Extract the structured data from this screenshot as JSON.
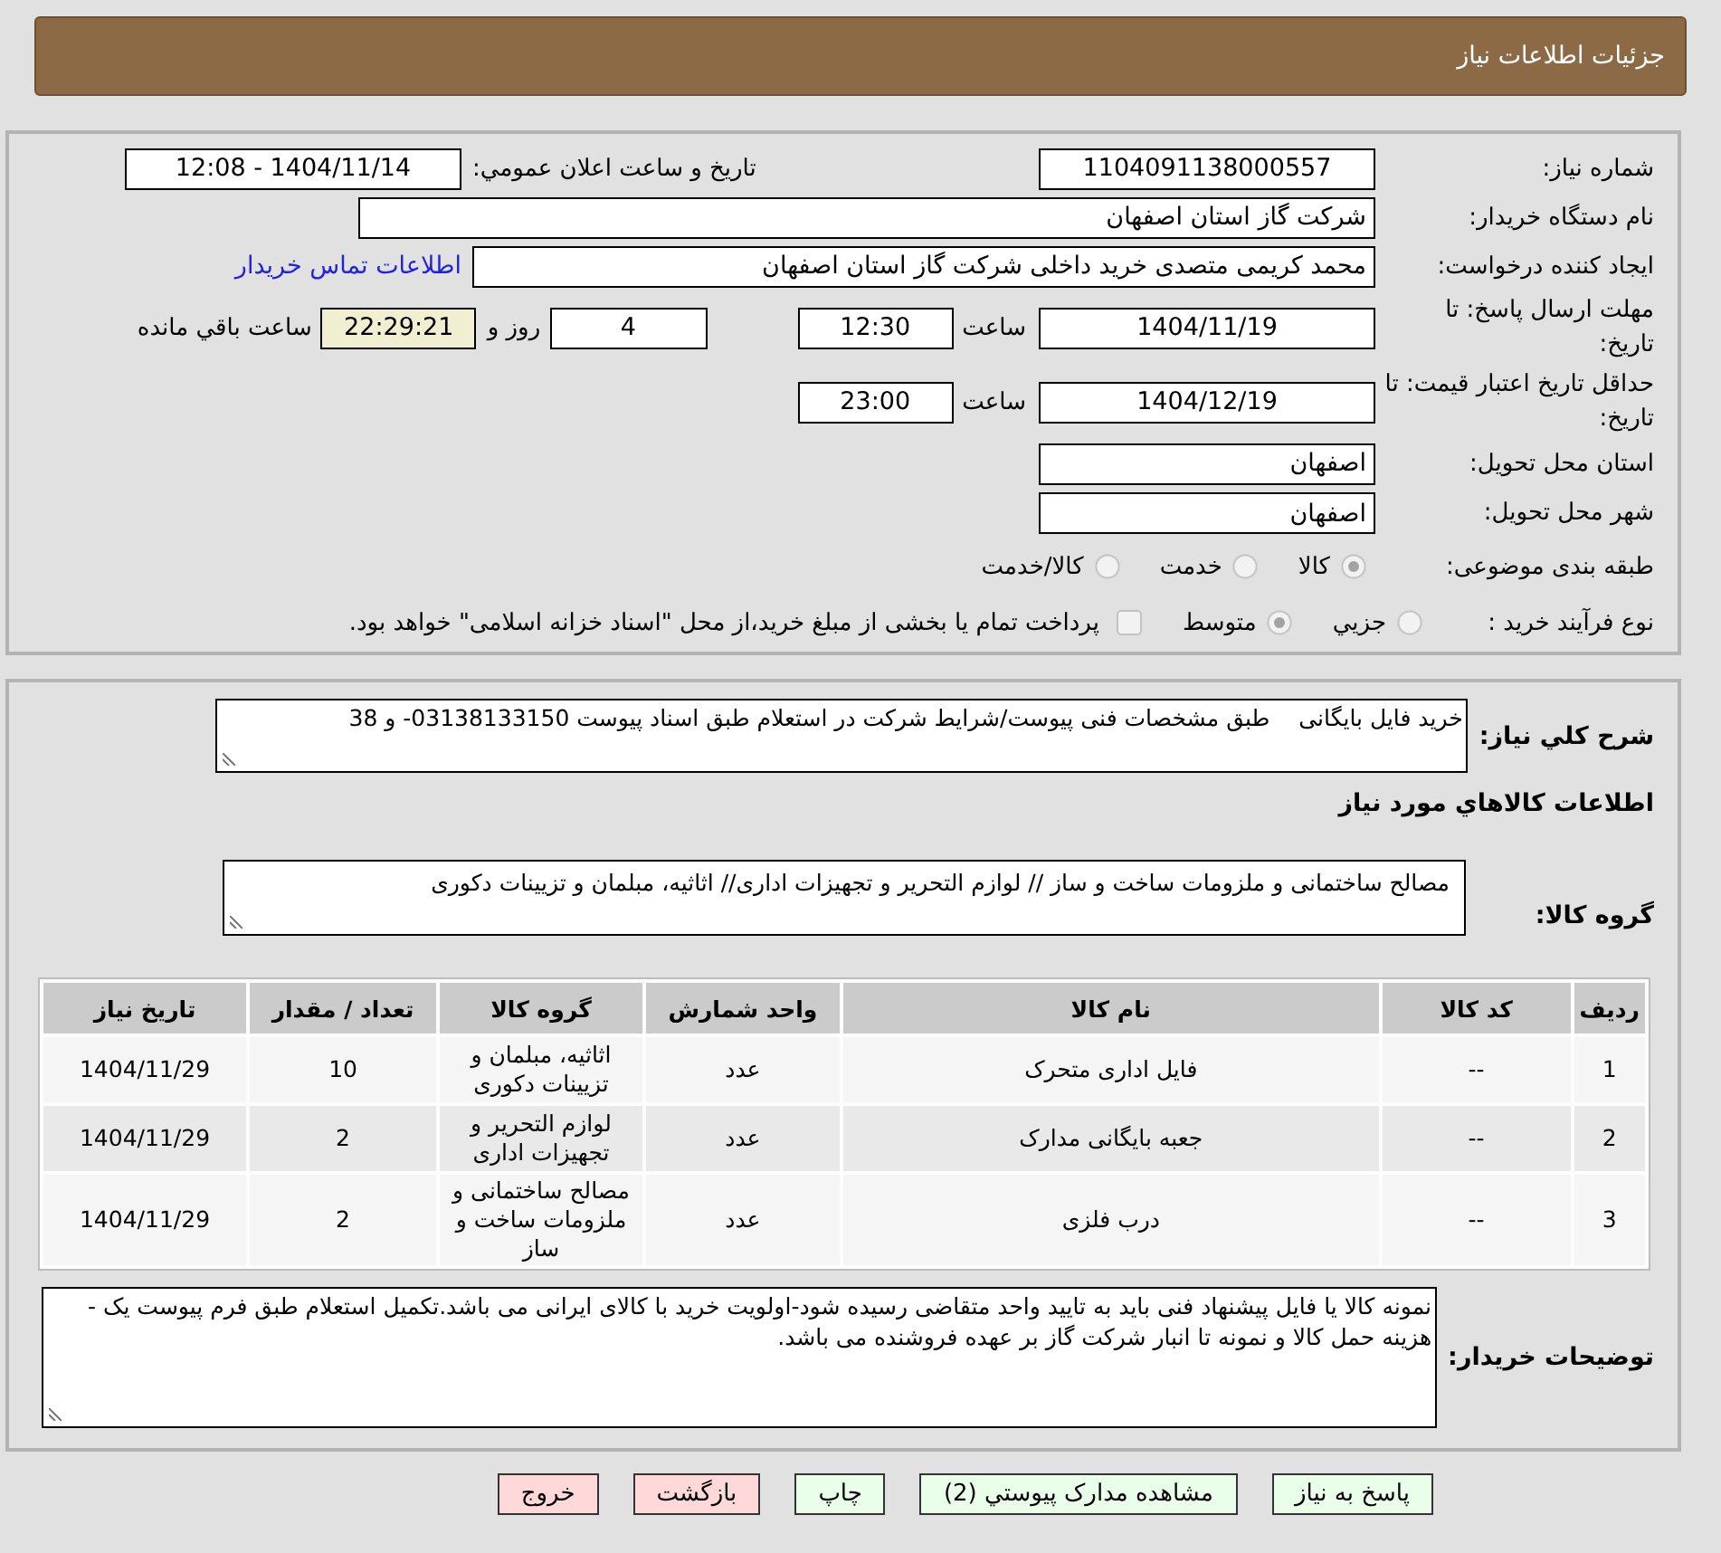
{
  "header": {
    "title": "جزئیات اطلاعات نیاز"
  },
  "need_info": {
    "need_number": {
      "label": "شماره نیاز:",
      "value": "1104091138000557"
    },
    "announcement": {
      "label": "تاریخ و ساعت اعلان عمومي:",
      "value": "1404/11/14 - 12:08"
    },
    "buyer_org": {
      "label": "نام دستگاه خریدار:",
      "value": "شرکت گاز استان اصفهان"
    },
    "requester": {
      "label": "ایجاد کننده درخواست:",
      "value": "محمد کریمی متصدی خرید داخلی شرکت گاز استان اصفهان",
      "contact_link": "اطلاعات تماس خریدار"
    },
    "response_deadline": {
      "label": "مهلت ارسال پاسخ: تا تاریخ:",
      "date": "1404/11/19",
      "time_label": "ساعت",
      "time": "12:30",
      "days": "4",
      "days_label": "روز و",
      "remaining": "22:29:21",
      "remaining_label": "ساعت باقي مانده"
    },
    "price_validity": {
      "label": "حداقل تاریخ اعتبار قیمت: تا تاریخ:",
      "date": "1404/12/19",
      "time_label": "ساعت",
      "time": "23:00"
    },
    "delivery_province": {
      "label": "استان محل تحویل:",
      "value": "اصفهان"
    },
    "delivery_city": {
      "label": "شهر محل تحویل:",
      "value": "اصفهان"
    },
    "subject_category": {
      "label": "طبقه بندی موضوعی:",
      "options": [
        {
          "label": "کالا",
          "selected": true
        },
        {
          "label": "خدمت",
          "selected": false
        },
        {
          "label": "کالا/خدمت",
          "selected": false
        }
      ]
    },
    "purchase_process": {
      "label": "نوع فرآیند خرید :",
      "options": [
        {
          "label": "جزيي",
          "selected": false
        },
        {
          "label": "متوسط",
          "selected": true
        }
      ],
      "treasury_payment": {
        "label": "پرداخت تمام یا بخشی از مبلغ خرید،از محل \"اسناد خزانه اسلامی\" خواهد بود.",
        "checked": false
      }
    }
  },
  "description": {
    "label": "شرح کلي نیاز:",
    "value": "خرید فایل بایگانی    طبق مشخصات فنی پیوست/شرایط شرکت در استعلام طبق اسناد پیوست 03138133150- و 38"
  },
  "goods": {
    "heading": "اطلاعات کالاهاي مورد نیاز",
    "group": {
      "label": "گروه کالا:",
      "value": "مصالح ساختمانی و ملزومات ساخت و ساز // لوازم التحریر و تجهیزات اداری// اثاثیه، مبلمان و تزیینات دکوری"
    },
    "table": {
      "columns": [
        "ردیف",
        "کد کالا",
        "نام کالا",
        "واحد شمارش",
        "گروه کالا",
        "تعداد / مقدار",
        "تاریخ نیاز"
      ],
      "rows": [
        [
          "1",
          "--",
          "فایل اداری متحرک",
          "عدد",
          "اثاثیه، مبلمان و تزیینات دکوری",
          "10",
          "1404/11/29"
        ],
        [
          "2",
          "--",
          "جعبه بایگانی مدارک",
          "عدد",
          "لوازم التحریر و تجهیزات اداری",
          "2",
          "1404/11/29"
        ],
        [
          "3",
          "--",
          "درب فلزی",
          "عدد",
          "مصالح ساختمانی و ملزومات ساخت و ساز",
          "2",
          "1404/11/29"
        ]
      ]
    }
  },
  "buyer_notes": {
    "label": "توضیحات خریدار:",
    "value": "نمونه کالا یا فایل پیشنهاد فنی باید به تایید واحد متقاضی رسیده شود-اولویت خرید با کالای ایرانی می باشد.تکمیل استعلام طبق فرم پیوست یک - هزینه حمل کالا و نمونه تا انبار شرکت گاز بر عهده فروشنده می باشد."
  },
  "buttons": [
    {
      "label": "پاسخ به نیاز",
      "kind": "action"
    },
    {
      "label": "مشاهده مدارک پیوستي (2)",
      "kind": "action"
    },
    {
      "label": "چاپ",
      "kind": "action"
    },
    {
      "label": "بازگشت",
      "kind": "cancel"
    },
    {
      "label": "خروج",
      "kind": "cancel"
    }
  ]
}
